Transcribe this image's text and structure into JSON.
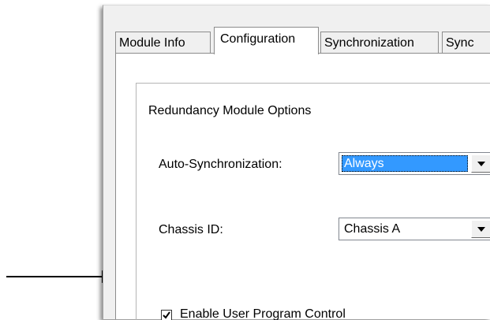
{
  "tabs": [
    {
      "label": "Module Info"
    },
    {
      "label": "Configuration"
    },
    {
      "label": "Synchronization"
    },
    {
      "label": "Sync"
    }
  ],
  "group": {
    "title": "Redundancy Module Options"
  },
  "auto_sync": {
    "label": "Auto-Synchronization:",
    "value": "Always"
  },
  "chassis": {
    "label": "Chassis ID:",
    "value": "Chassis A"
  },
  "enable_control": {
    "label": "Enable User Program Control",
    "checked": true
  },
  "icons": {
    "callout": "arrow-right-icon",
    "dropdown": "chevron-down-icon",
    "check": "checkmark-icon"
  }
}
